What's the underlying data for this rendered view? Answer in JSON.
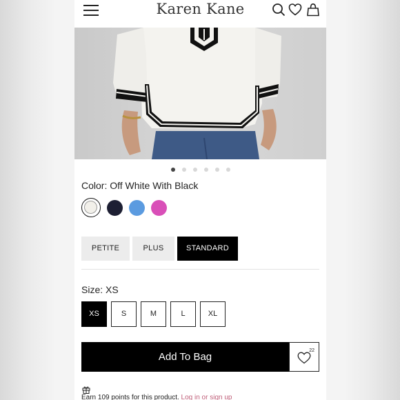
{
  "header": {
    "brand": "Karen Kane",
    "icons": [
      "menu-icon",
      "search-icon",
      "heart-icon",
      "bag-icon"
    ]
  },
  "carousel": {
    "total": 6,
    "active_index": 1
  },
  "color": {
    "label": "Color: Off White With Black",
    "swatches": [
      {
        "name": "off-white-with-black",
        "color": "#f2f0ea",
        "selected": true
      },
      {
        "name": "navy",
        "color": "#1d1f33",
        "selected": false
      },
      {
        "name": "blue",
        "color": "#5b9be0",
        "selected": false
      },
      {
        "name": "pink",
        "color": "#d94fb8",
        "selected": false
      }
    ]
  },
  "fit": {
    "options": [
      "PETITE",
      "PLUS",
      "STANDARD"
    ],
    "selected": "STANDARD"
  },
  "size": {
    "label": "Size: XS",
    "options": [
      "XS",
      "S",
      "M",
      "L",
      "XL"
    ],
    "selected": "XS"
  },
  "cart": {
    "add_label": "Add To Bag",
    "wishlist_count": "22"
  },
  "rewards": {
    "text": "Earn 109 points for this product.",
    "link": "Log in or sign up"
  },
  "colors": {
    "primary": "#000000",
    "link": "#c0607a",
    "inactive_bg": "#ececec"
  }
}
